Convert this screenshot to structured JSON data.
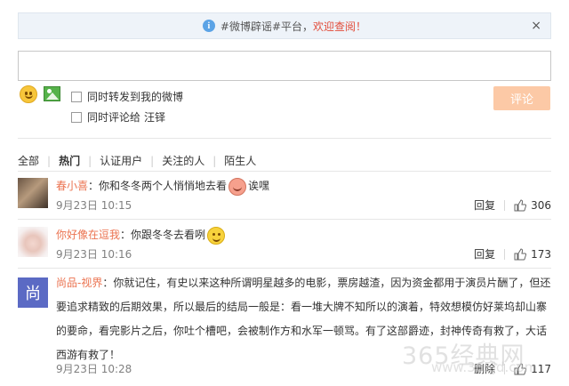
{
  "notice": {
    "prefix": "#微博辟谣#平台，",
    "link": "欢迎查阅！",
    "close": "×"
  },
  "composer": {
    "input_value": "",
    "option_repost_label": "同时转发到我的微博",
    "option_comment_label_prefix": "同时评论给",
    "option_comment_target": "汪铎",
    "submit_label": "评论"
  },
  "tabs": [
    "全部",
    "热门",
    "认证用户",
    "关注的人",
    "陌生人"
  ],
  "active_tab": "热门",
  "comments": [
    {
      "user": "春小喜",
      "text_before": "你和冬冬两个人悄悄地去看",
      "text_after": "诶嘿",
      "emoji": "shy-emoji",
      "time": "9月23日 10:15",
      "reply_label": "回复",
      "likes": "306"
    },
    {
      "user": "你好像在逗我",
      "text_before": "你跟冬冬去看咧",
      "text_after": "",
      "emoji": "smile-emoji",
      "time": "9月23日 10:16",
      "reply_label": "回复",
      "likes": "173"
    },
    {
      "user": "尚品-视界",
      "avatar_char": "尚",
      "text_before": "你就记住，有史以来这种所谓明星越多的电影，票房越渣，因为资金都用于演员片酬了，但还要追求精致的后期效果，所以最后的结局一般是：看一堆大牌不知所以的演着，特效想模仿好莱坞却山寨的要命，看完影片之后，你吐个槽吧，会被制作方和水军一顿骂。有了这部爵迹，封神传奇有救了，大话西游有救了！",
      "text_after": "",
      "time": "9月23日 10:28",
      "reply_label": "删除",
      "likes": "117"
    }
  ],
  "watermark": {
    "main": "365经典网",
    "sub": "www.365jd.com"
  },
  "colors": {
    "username": "#eb7350",
    "notice_link": "#e24e3c",
    "submit_bg": "#fcc9a6",
    "notice_bg": "#eef3f9"
  }
}
